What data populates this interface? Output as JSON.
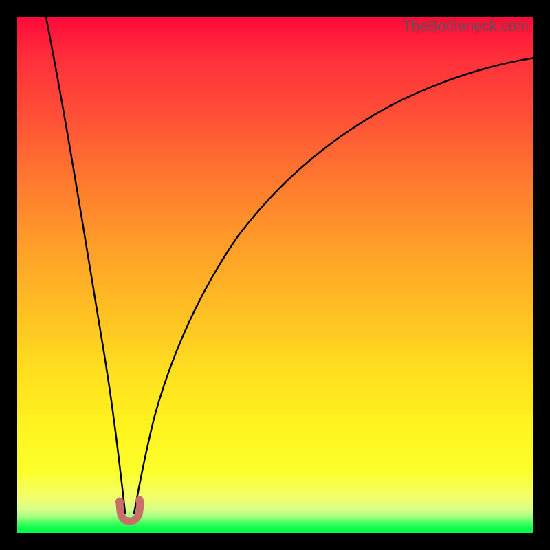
{
  "attribution": "TheBottleneck.com",
  "colors": {
    "frame": "#000000",
    "gradient_top": "#ff0a3a",
    "gradient_mid": "#ffe21f",
    "gradient_bottom": "#03ff43",
    "curve": "#000000",
    "marker": "#c96f6a"
  },
  "chart_data": {
    "type": "line",
    "title": "",
    "xlabel": "",
    "ylabel": "",
    "xlim": [
      0,
      100
    ],
    "ylim": [
      0,
      100
    ],
    "grid": false,
    "legend": false,
    "annotations": [],
    "series": [
      {
        "name": "bottleneck-curve",
        "color": "#000000",
        "x": [
          5,
          7,
          9,
          11,
          13,
          15,
          17,
          18.5,
          19.5,
          20.5,
          21.5,
          23,
          25,
          28,
          32,
          37,
          43,
          50,
          58,
          67,
          77,
          88,
          100
        ],
        "y": [
          100,
          89,
          78,
          67,
          56,
          44,
          31,
          18,
          9,
          4,
          8,
          17,
          27,
          38,
          48,
          57,
          65,
          72,
          78,
          83,
          87,
          90,
          92
        ]
      }
    ],
    "markers": [
      {
        "name": "valley-marker-left",
        "x": 19.0,
        "y": 5.0,
        "color": "#c96f6a"
      },
      {
        "name": "valley-marker-mid",
        "x": 20.0,
        "y": 3.0,
        "color": "#c96f6a"
      },
      {
        "name": "valley-marker-right",
        "x": 21.0,
        "y": 5.0,
        "color": "#c96f6a"
      }
    ],
    "notes": "Axes are unlabeled in the source image; x and y are normalized 0-100 estimates read from pixel positions. y=0 is the bottom (green) edge, y=100 is the top (red) edge. The curve descends steeply from upper-left, reaches a near-zero minimum around x≈20, then rises asymptotically toward upper-right."
  }
}
